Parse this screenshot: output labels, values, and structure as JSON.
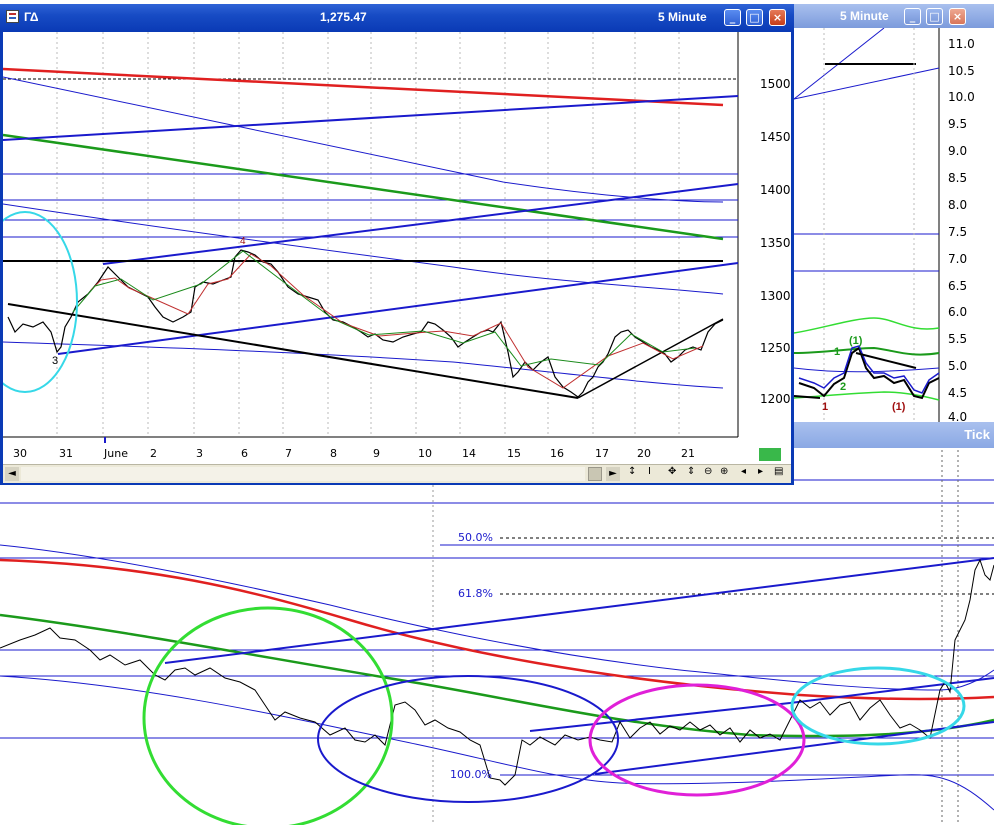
{
  "colors": {
    "xp_blue": "#0a3ab5",
    "red": "#e02020",
    "green": "#1b9a1b",
    "blue": "#1a1acc",
    "black": "#000000",
    "cyan": "#36d8e8",
    "magenta": "#e020d8",
    "lime": "#33dd33"
  },
  "background_chart": {
    "fib_levels": [
      {
        "label": "50.0%"
      },
      {
        "label": "61.8%"
      },
      {
        "label": "100.0%"
      }
    ],
    "tick_window_label": "Tick"
  },
  "main_window": {
    "icon": "chart-window-icon",
    "symbol": "ΓΔ",
    "last_price": "1,275.47",
    "interval": "5 Minute",
    "minimize": "_",
    "maximize": "□",
    "close": "×",
    "y_labels": [
      "1500",
      "1450",
      "1400",
      "1350",
      "1300",
      "1250",
      "1200"
    ],
    "x_labels": [
      "30",
      "31",
      "June",
      "2",
      "3",
      "6",
      "7",
      "8",
      "9",
      "10",
      "14",
      "15",
      "16",
      "17",
      "20",
      "21"
    ],
    "wave_labels": [
      "3",
      "4"
    ],
    "scroll_buttons": [
      "◄",
      "►"
    ],
    "toolbar_icons": [
      {
        "name": "sync-icon",
        "glyph": "↕"
      },
      {
        "name": "cursor-icon",
        "glyph": "I"
      },
      {
        "name": "move-icon",
        "glyph": "✥"
      },
      {
        "name": "vertical-scale-icon",
        "glyph": "⇕"
      },
      {
        "name": "zoom-out-icon",
        "glyph": "⊖"
      },
      {
        "name": "zoom-in-icon",
        "glyph": "⊕"
      },
      {
        "name": "scroll-left-icon",
        "glyph": "◂"
      },
      {
        "name": "scroll-right-icon",
        "glyph": "▸"
      },
      {
        "name": "data-window-icon",
        "glyph": "▤"
      }
    ]
  },
  "second_window": {
    "interval": "5 Minute",
    "minimize": "_",
    "maximize": "□",
    "close": "×",
    "y_labels": [
      "11.0",
      "10.5",
      "10.0",
      "9.5",
      "9.0",
      "8.5",
      "8.0",
      "7.5",
      "7.0",
      "6.5",
      "6.0",
      "5.5",
      "5.0",
      "4.5",
      "4.0"
    ],
    "wave_labels": [
      "1",
      "(1)",
      "2",
      "1",
      "(1)"
    ]
  }
}
